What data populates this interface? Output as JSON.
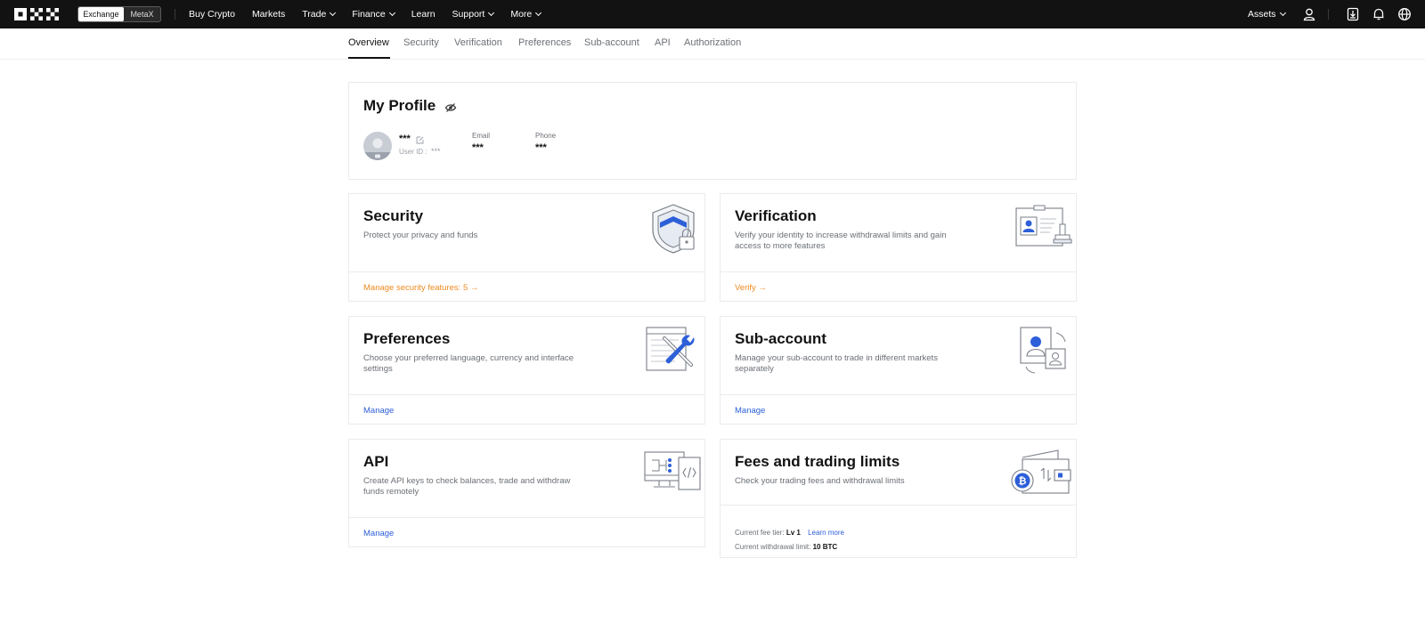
{
  "topnav": {
    "switch": {
      "exchange": "Exchange",
      "metax": "MetaX"
    },
    "links": [
      {
        "label": "Buy Crypto",
        "dropdown": false
      },
      {
        "label": "Markets",
        "dropdown": false
      },
      {
        "label": "Trade",
        "dropdown": true
      },
      {
        "label": "Finance",
        "dropdown": true
      },
      {
        "label": "Learn",
        "dropdown": false
      },
      {
        "label": "Support",
        "dropdown": true
      },
      {
        "label": "More",
        "dropdown": true
      }
    ],
    "assets": "Assets"
  },
  "subnav": {
    "tabs": [
      "Overview",
      "Security",
      "Verification",
      "Preferences",
      "Sub-account",
      "API",
      "Authorization"
    ],
    "active": "Overview"
  },
  "profile": {
    "title": "My Profile",
    "name": "***",
    "user_id_label": "User ID :",
    "user_id": "***",
    "email_label": "Email",
    "email": "***",
    "phone_label": "Phone",
    "phone": "***"
  },
  "cards": {
    "security": {
      "title": "Security",
      "desc": "Protect your privacy and funds",
      "link": "Manage security features: 5 →"
    },
    "verification": {
      "title": "Verification",
      "desc": "Verify your identity to increase withdrawal limits and gain access to more features",
      "link": "Verify →"
    },
    "preferences": {
      "title": "Preferences",
      "desc": "Choose your preferred language, currency and interface settings",
      "link": "Manage"
    },
    "subaccount": {
      "title": "Sub-account",
      "desc": "Manage your sub-account to trade in different markets separately",
      "link": "Manage"
    },
    "api": {
      "title": "API",
      "desc": "Create API keys to check balances, trade and withdraw funds remotely",
      "link": "Manage"
    },
    "fees": {
      "title": "Fees and trading limits",
      "desc": "Check your trading fees and withdrawal limits",
      "fee_tier_label": "Current fee tier:",
      "fee_tier": "Lv 1",
      "learn_more": "Learn more",
      "withdrawal_label": "Current withdrawal limit:",
      "withdrawal": "10 BTC"
    }
  },
  "colors": {
    "accent_orange": "#f08a1f",
    "link_blue": "#2d5fd8",
    "nav_bg": "#121212"
  }
}
